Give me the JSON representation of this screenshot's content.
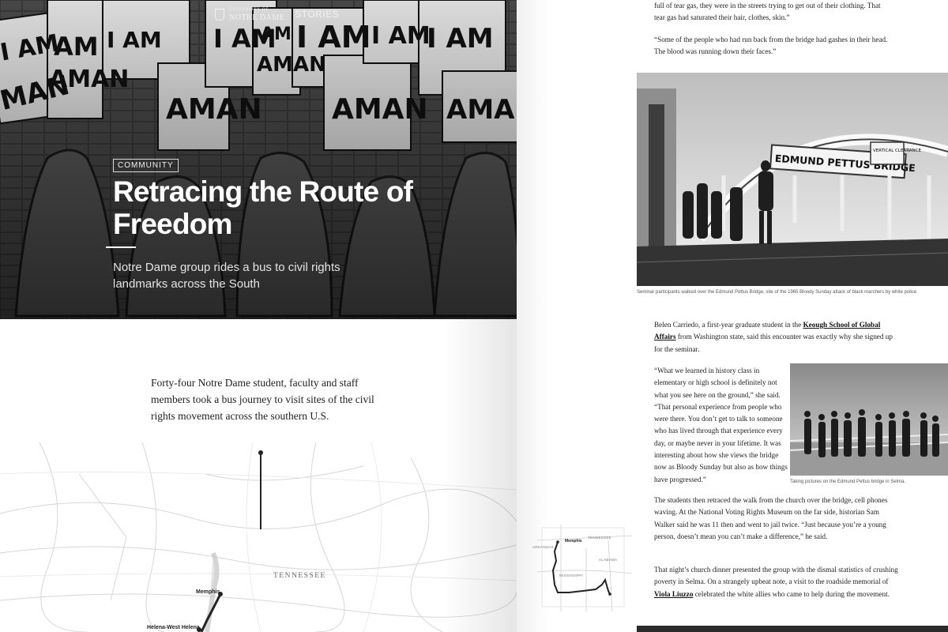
{
  "brand": {
    "university_small": "UNIVERSITY OF",
    "university": "NOTRE DAME",
    "section": "STORIES"
  },
  "hero": {
    "category": "COMMUNITY",
    "title": "Retracing the Route of Freedom",
    "dek": "Notre Dame group rides a bus to civil rights landmarks across the South",
    "mural_text": [
      "I AM",
      "A MAN"
    ]
  },
  "intro": "Forty-four Notre Dame student, faculty and staff members took a bus journey to visit sites of the civil rights movement across the southern U.S.",
  "map": {
    "state_label": "TENNESSEE",
    "cities": [
      "Memphis",
      "Helena-West Helena"
    ]
  },
  "article": {
    "p1": "full of tear gas, they were in the streets trying to get out of their clothing. That tear gas had saturated their hair, clothes, skin.”",
    "p2": "“Some of the people who had run back from the bridge had gashes in their head. The blood was running down their faces.”",
    "photo1_sign": "EDMUND PETTUS BRIDGE",
    "photo1_sign2": "VERTICAL CLEARANCE",
    "caption1": "Seminar participants walked over the Edmund Pettus Bridge, site of the 1965 Bloody Sunday attack of black marchers by white police.",
    "p3_a": "Belen Carriedo, a first-year graduate student in the ",
    "p3_link": "Keough School of Global Affairs",
    "p3_b": " from Washington state, said this encounter was exactly why she signed up for the seminar.",
    "quote": "“What we learned in history class in elementary or high school is definitely not what you see here on the ground,” she said. “That personal experience from people who were there. You don’t get to talk to someone who has lived through that experience every day, or maybe never in your lifetime. It was interesting about how she views the bridge now as Bloody Sunday but also as how things have progressed.”",
    "caption2": "Taking pictures on the Edmund Pettus bridge in Selma.",
    "p4": "The students then retraced the walk from the church over the bridge, cell phones waving. At the National Voting Rights Museum on the far side, historian Sam Walker said he was 11 then and went to jail twice. “Just because you’re a young person, doesn’t mean you can’t make a difference,” he said.",
    "p5_a": "That night’s church dinner presented the group with the dismal statistics of crushing poverty in Selma. On a strangely upbeat note, a visit to the roadside memorial of ",
    "p5_link": "Viola Liuzzo",
    "p5_b": " celebrated the white allies who came to help during the movement."
  },
  "mini_map": {
    "city": "Memphis",
    "labels": [
      "ARKANSAS",
      "TENNESSEE",
      "MISSISSIPPI",
      "ALABAMA"
    ]
  },
  "colors": {
    "text": "#222222",
    "hero_bg": "#2b2b2b",
    "page_bg": "#ffffff"
  }
}
